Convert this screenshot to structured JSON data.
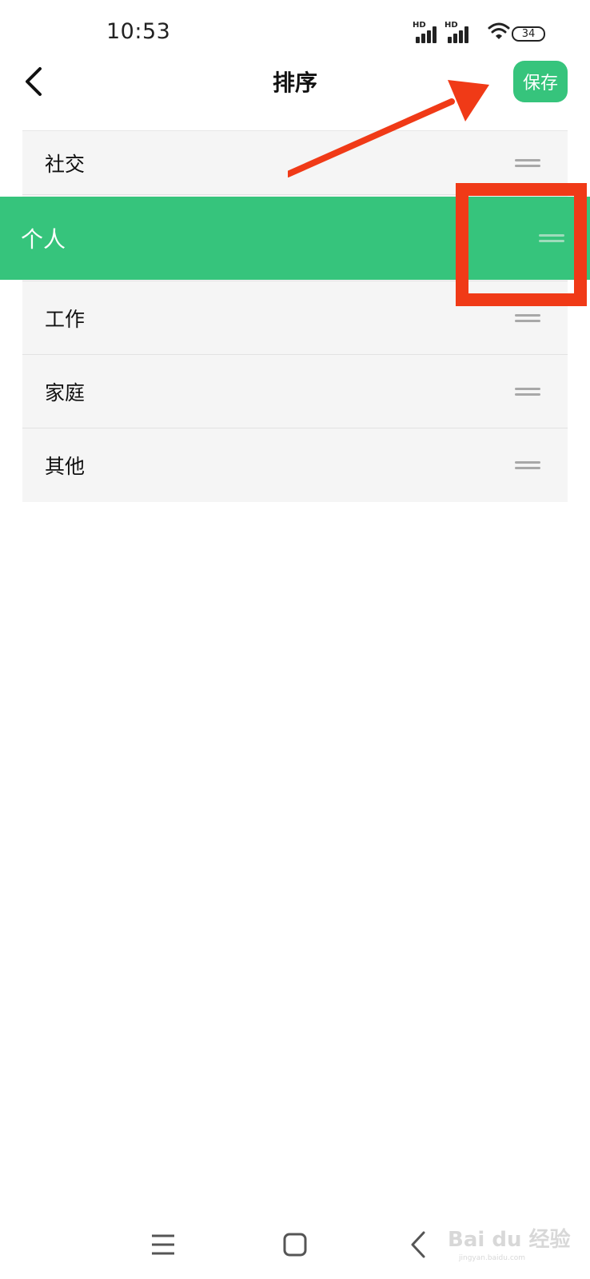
{
  "status_bar": {
    "time": "10:53",
    "signal_label": "HD",
    "battery": "34"
  },
  "header": {
    "title": "排序",
    "save_label": "保存"
  },
  "list": {
    "items": [
      {
        "label": "社交"
      },
      {
        "label": "个人",
        "state": "dragging"
      },
      {
        "label": "工作"
      },
      {
        "label": "家庭"
      },
      {
        "label": "其他"
      }
    ]
  },
  "colors": {
    "accent": "#36c47c",
    "annotation": "#f03a17",
    "list_background": "#f5f5f5",
    "handle": "#a8a8a8"
  },
  "icons": {
    "back": "chevron-left-icon",
    "drag": "drag-handle-icon",
    "nav_menu": "menu-icon",
    "nav_home": "home-square-icon",
    "nav_back": "back-triangle-icon"
  },
  "watermark": {
    "brand": "Bai du 经验",
    "url": "jingyan.baidu.com"
  }
}
